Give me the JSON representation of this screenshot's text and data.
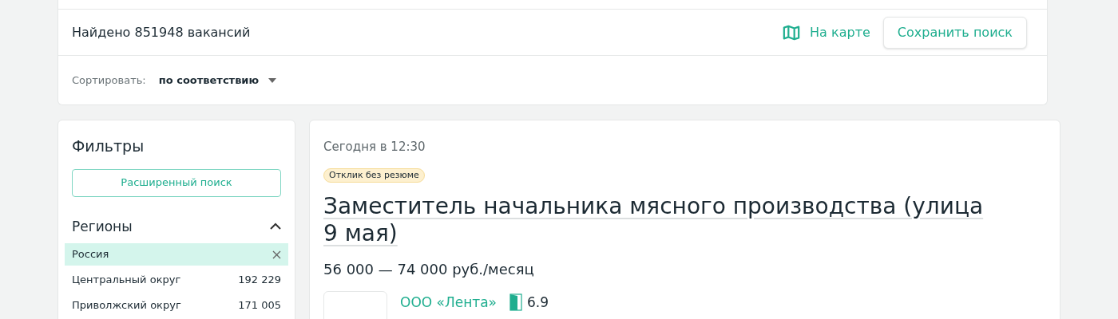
{
  "results": {
    "found": "Найдено 851948 вакансий",
    "map_link": "На карте",
    "save_button": "Сохранить поиск"
  },
  "sort": {
    "label": "Сортировать:",
    "value": "по соответствию"
  },
  "filters": {
    "title": "Фильтры",
    "advanced_button": "Расширенный поиск",
    "regions": {
      "title": "Регионы",
      "expanded": true,
      "items": [
        {
          "name": "Россия",
          "selected": true
        },
        {
          "name": "Центральный округ",
          "count": "192 229",
          "selected": false
        },
        {
          "name": "Приволжский округ",
          "count": "171 005",
          "selected": false
        }
      ]
    }
  },
  "vacancy": {
    "date": "Сегодня в 12:30",
    "badge": "Отклик без резюме",
    "title": "Заместитель начальника мясного производства (улица 9 мая)",
    "salary": "56 000 — 74 000 руб./месяц",
    "company": "ООО «Лента»",
    "rating": "6.9"
  }
}
